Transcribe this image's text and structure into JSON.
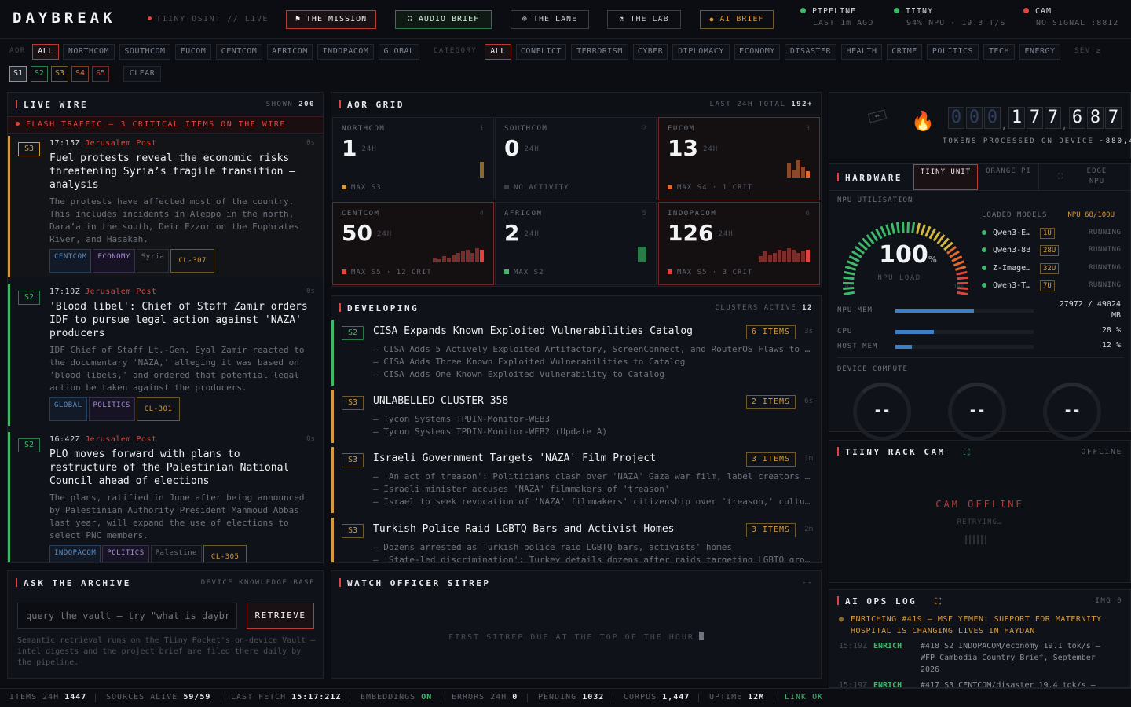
{
  "topbar": {
    "logo": "DAYBREAK",
    "subtitle": "TIINY OSINT // LIVE",
    "buttons": [
      {
        "label": "THE MISSION",
        "icon": "flag-icon"
      },
      {
        "label": "AUDIO BRIEF",
        "icon": "headset-icon"
      },
      {
        "label": "THE LANE",
        "icon": "globe-icon"
      },
      {
        "label": "THE LAB",
        "icon": "flask-icon"
      },
      {
        "label": "AI BRIEF",
        "icon": "dot-icon"
      }
    ],
    "status": [
      {
        "key": "PIPELINE",
        "value": "LAST 1m AGO",
        "color": "#3fb86a"
      },
      {
        "key": "TIINY",
        "value": "94% NPU · 19.3 T/S",
        "color": "#3fb86a"
      },
      {
        "key": "CAM",
        "value": "NO SIGNAL :8812",
        "color": "#e0443e"
      }
    ]
  },
  "filters": {
    "aor_label": "AOR",
    "aor": [
      "ALL",
      "NORTHCOM",
      "SOUTHCOM",
      "EUCOM",
      "CENTCOM",
      "AFRICOM",
      "INDOPACOM",
      "GLOBAL"
    ],
    "category_label": "CATEGORY",
    "categories": [
      "ALL",
      "CONFLICT",
      "TERRORISM",
      "CYBER",
      "DIPLOMACY",
      "ECONOMY",
      "DISASTER",
      "HEALTH",
      "CRIME",
      "POLITICS",
      "TECH",
      "ENERGY"
    ],
    "sev_label": "SEV ≥",
    "sev": [
      "S1",
      "S2",
      "S3",
      "S4",
      "S5"
    ],
    "clear": "CLEAR"
  },
  "live_wire": {
    "title": "LIVE WIRE",
    "shown_label": "SHOWN",
    "shown": "200",
    "flash": "FLASH TRAFFIC — 3 CRITICAL ITEMS ON THE WIRE",
    "items": [
      {
        "sev": "S3",
        "time": "17:15Z",
        "source": "Jerusalem Post",
        "age": "0s",
        "headline": "Fuel protests reveal the economic risks threatening Syria’s fragile transition – analysis",
        "body": "The protests have affected most of the country. This includes incidents in Aleppo in the north, Dara’a in the south, Deir Ezzor on the Euphrates River, and Hasakah.",
        "tags": [
          "CENTCOM",
          "ECONOMY",
          "Syria",
          "CL-307"
        ]
      },
      {
        "sev": "S2",
        "time": "17:10Z",
        "source": "Jerusalem Post",
        "age": "0s",
        "headline": "'Blood libel': Chief of Staff Zamir orders IDF to pursue legal action against 'NAZA' producers",
        "body": "IDF Chief of Staff Lt.-Gen. Eyal Zamir reacted to the documentary 'NAZA,' alleging it was based on 'blood libels,' and ordered that potential legal action be taken against the producers.",
        "tags": [
          "GLOBAL",
          "POLITICS",
          "CL-301"
        ]
      },
      {
        "sev": "S2",
        "time": "16:42Z",
        "source": "Jerusalem Post",
        "age": "0s",
        "headline": "PLO moves forward with plans to restructure of the Palestinian National Council ahead of elections",
        "body": "The plans, ratified in June after being announced by Palestinian Authority President Mahmoud Abbas last year, will expand the use of elections to select PNC members.",
        "tags": [
          "INDOPACOM",
          "POLITICS",
          "Palestine",
          "CL-305"
        ]
      }
    ]
  },
  "aor_grid": {
    "title": "AOR GRID",
    "right_prefix": "LAST 24H TOTAL",
    "total": "192+",
    "unit": "24H",
    "cells": [
      {
        "name": "NORTHCOM",
        "idx": "1",
        "count": "1",
        "foot": "MAX S3",
        "color": "#d49a3e"
      },
      {
        "name": "SOUTHCOM",
        "idx": "2",
        "count": "0",
        "foot": "NO ACTIVITY",
        "color": "#3a3e46"
      },
      {
        "name": "EUCOM",
        "idx": "3",
        "count": "13",
        "foot": "MAX S4 · 1 CRIT",
        "color": "#e06a2e"
      },
      {
        "name": "CENTCOM",
        "idx": "4",
        "count": "50",
        "foot": "MAX S5 · 12 CRIT",
        "color": "#e0443e"
      },
      {
        "name": "AFRICOM",
        "idx": "5",
        "count": "2",
        "foot": "MAX S2",
        "color": "#3fb86a"
      },
      {
        "name": "INDOPACOM",
        "idx": "6",
        "count": "126",
        "foot": "MAX S5 · 3 CRIT",
        "color": "#e0443e"
      }
    ]
  },
  "developing": {
    "title": "DEVELOPING",
    "right_label": "CLUSTERS ACTIVE",
    "count": "12",
    "clusters": [
      {
        "sev": "S2",
        "title": "CISA Expands Known Exploited Vulnerabilities Catalog",
        "items": "6 ITEMS",
        "age": "3s",
        "subs": [
          "– CISA Adds 5 Actively Exploited Artifactory, ScreenConnect, and RouterOS Flaws to KEV",
          "– CISA Adds Three Known Exploited Vulnerabilities to Catalog",
          "– CISA Adds One Known Exploited Vulnerability to Catalog"
        ]
      },
      {
        "sev": "S3",
        "title": "UNLABELLED CLUSTER 358",
        "items": "2 ITEMS",
        "age": "6s",
        "subs": [
          "– Tycon Systems TPDIN-Monitor-WEB3",
          "– Tycon Systems TPDIN-Monitor-WEB2 (Update A)"
        ]
      },
      {
        "sev": "S3",
        "title": "Israeli Government Targets 'NAZA' Film Project",
        "items": "3 ITEMS",
        "age": "1m",
        "subs": [
          "– 'An act of treason': Politicians clash over 'NAZA' Gaza war film, label creators 'Israel's enemies'",
          "– Israeli minister accuses 'NAZA' filmmakers of 'treason'",
          "– Israel to seek revocation of 'NAZA' filmmakers' citizenship over 'treason,' culture minister says"
        ]
      },
      {
        "sev": "S3",
        "title": "Turkish Police Raid LGBTQ Bars and Activist Homes",
        "items": "3 ITEMS",
        "age": "2m",
        "subs": [
          "– Dozens arrested as Turkish police raid LGBTQ bars, activists' homes",
          "– 'State-led discrimination': Turkey details dozens after raids targeting LGBTQ groups"
        ]
      }
    ]
  },
  "tokens": {
    "digits": [
      "0",
      "0",
      "0",
      "1",
      "7",
      "7",
      "6",
      "8",
      "7"
    ],
    "label": "TOKENS PROCESSED ON DEVICE",
    "rate": "~880,455"
  },
  "hardware": {
    "title": "HARDWARE",
    "tabs": [
      "TIINY UNIT",
      "ORANGE PI",
      "EDGE NPU"
    ],
    "npu_label": "NPU UTILISATION",
    "npu_value": "100",
    "npu_pct": "%",
    "npu_sub": "NPU LOAD",
    "npu_min": "0",
    "npu_max": "100",
    "npu_fraction": 1.0,
    "loaded_label": "LOADED MODELS",
    "loaded_value": "NPU 68/100U",
    "models": [
      {
        "name": "Qwen3-E…",
        "quota": "1U",
        "state": "RUNNING"
      },
      {
        "name": "Qwen3-8B",
        "quota": "28U",
        "state": "RUNNING"
      },
      {
        "name": "Z-Image…",
        "quota": "32U",
        "state": "RUNNING"
      },
      {
        "name": "Qwen3-T…",
        "quota": "7U",
        "state": "RUNNING"
      }
    ],
    "meters": [
      {
        "label": "NPU MEM",
        "value": "27972 / 49024 MB",
        "fraction": 0.57
      },
      {
        "label": "CPU",
        "value": "28 %",
        "fraction": 0.28
      },
      {
        "label": "HOST MEM",
        "value": "12 %",
        "fraction": 0.12
      }
    ],
    "compute_label": "DEVICE COMPUTE",
    "compute": [
      "--",
      "--",
      "--"
    ]
  },
  "rack_cam": {
    "title": "TIINY RACK CAM",
    "status": "OFFLINE",
    "offline": "CAM OFFLINE",
    "retry": "RETRYING…"
  },
  "ai_ops": {
    "title": "AI OPS LOG",
    "img_label": "IMG 0",
    "current": "ENRICHING #419 — MSF YEMEN: SUPPORT FOR MATERNITY HOSPITAL IS CHANGING LIVES IN HAYDAN",
    "logs": [
      {
        "time": "15:19Z",
        "event": "ENRICH",
        "msg": "#418 S2 INDOPACOM/economy 19.1 tok/s — WFP Cambodia Country Brief, September 2026"
      },
      {
        "time": "15:19Z",
        "event": "ENRICH",
        "msg": "#417 S3 CENTCOM/disaster 19.4 tok/s — Yemen: Cash Assistance and Informal"
      }
    ]
  },
  "archive": {
    "title": "ASK THE ARCHIVE",
    "right": "DEVICE KNOWLEDGE BASE",
    "placeholder": "query the vault — try \"what is daybreak\"",
    "button": "RETRIEVE",
    "note": "Semantic retrieval runs on the Tiiny Pocket's on-device Vault — intel digests and the project brief are filed there daily by the pipeline."
  },
  "sitrep": {
    "title": "WATCH OFFICER SITREP",
    "right": "--",
    "message": "FIRST SITREP DUE AT THE TOP OF THE HOUR"
  },
  "statusbar": [
    {
      "label": "ITEMS 24H",
      "value": "1447"
    },
    {
      "label": "SOURCES ALIVE",
      "value": "59/59"
    },
    {
      "label": "LAST FETCH",
      "value": "15:17:21Z"
    },
    {
      "label": "EMBEDDINGS",
      "value": "ON"
    },
    {
      "label": "ERRORS 24H",
      "value": "0"
    },
    {
      "label": "PENDING",
      "value": "1032"
    },
    {
      "label": "CORPUS",
      "value": "1,447"
    },
    {
      "label": "UPTIME",
      "value": "12M"
    },
    {
      "label": "",
      "value": "LINK OK"
    }
  ],
  "colors": {
    "accent": "#e0443e",
    "ok": "#3fb86a",
    "warn": "#d49a3e",
    "s4": "#e06a2e"
  }
}
